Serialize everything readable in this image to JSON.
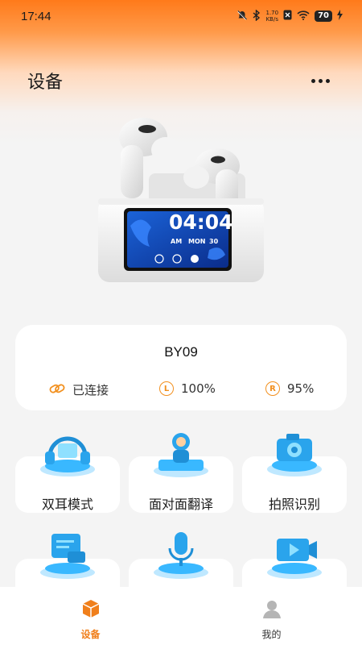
{
  "status_bar": {
    "time": "17:44",
    "net_speed_value": "1.70",
    "net_speed_unit": "KB/s",
    "battery": "70"
  },
  "header": {
    "title": "设备"
  },
  "device": {
    "name": "BY09",
    "connection_status": "已连接",
    "left_battery": "100%",
    "right_battery": "95%",
    "left_badge": "L",
    "right_badge": "R"
  },
  "case_screen": {
    "time": "04:04",
    "period": "AM",
    "weekday": "MON",
    "day": "30"
  },
  "features": [
    {
      "label": "双耳模式",
      "icon": "headphones-illustration"
    },
    {
      "label": "面对面翻译",
      "icon": "translator-illustration"
    },
    {
      "label": "拍照识别",
      "icon": "camera-illustration"
    },
    {
      "label": "",
      "icon": "chat-illustration"
    },
    {
      "label": "",
      "icon": "microphone-illustration"
    },
    {
      "label": "",
      "icon": "video-illustration"
    }
  ],
  "bottom_nav": [
    {
      "label": "设备",
      "active": true
    },
    {
      "label": "我的",
      "active": false
    }
  ],
  "colors": {
    "accent": "#f07f1b",
    "gradient_top": "#ff7a1a"
  }
}
